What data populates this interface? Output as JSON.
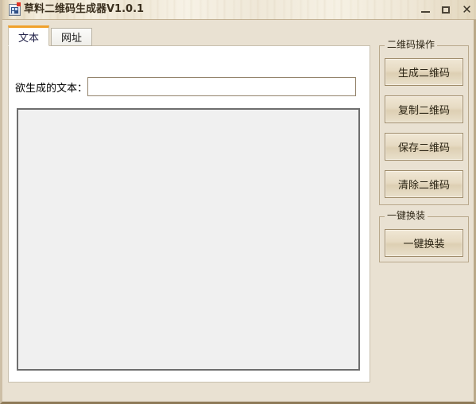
{
  "window": {
    "title": "草料二维码生成器V1.0.1",
    "icon": "app-qrcode-icon",
    "controls": {
      "minimize": "minimize-button",
      "maximize": "maximize-button",
      "close_glyph": "✕"
    },
    "colors": {
      "titlebar": "#f2ead8",
      "background": "#e9e1d2",
      "accent_tab": "#f0a12c",
      "button_face": "#e6dac2",
      "button_border": "#a08d6c"
    }
  },
  "tabs": [
    {
      "label": "文本",
      "active": true
    },
    {
      "label": "网址",
      "active": false
    }
  ],
  "form": {
    "text_label": "欲生成的文本：",
    "text_value": "",
    "text_placeholder": ""
  },
  "preview": {
    "content": ""
  },
  "panels": [
    {
      "title": "二维码操作",
      "buttons": [
        {
          "label": "生成二维码"
        },
        {
          "label": "复制二维码"
        },
        {
          "label": "保存二维码"
        },
        {
          "label": "清除二维码"
        }
      ]
    },
    {
      "title": "一键换装",
      "buttons": [
        {
          "label": "一键换装"
        }
      ]
    }
  ]
}
